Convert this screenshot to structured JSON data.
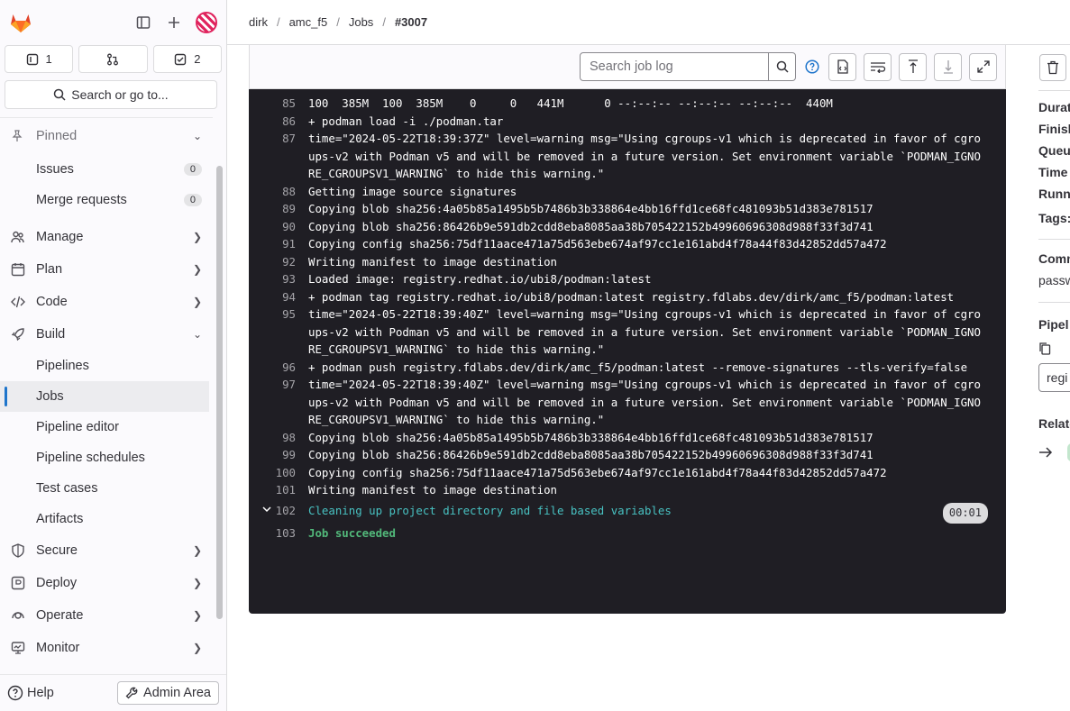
{
  "sidebar": {
    "issues_count": "1",
    "todos_count": "2",
    "search_label": "Search or go to...",
    "pinned_label": "Pinned",
    "pinned_items": [
      {
        "label": "Issues",
        "badge": "0"
      },
      {
        "label": "Merge requests",
        "badge": "0"
      }
    ],
    "sections": {
      "manage": "Manage",
      "plan": "Plan",
      "code": "Code",
      "build": "Build",
      "secure": "Secure",
      "deploy": "Deploy",
      "operate": "Operate",
      "monitor": "Monitor"
    },
    "build_items": [
      "Pipelines",
      "Jobs",
      "Pipeline editor",
      "Pipeline schedules",
      "Test cases",
      "Artifacts"
    ],
    "help_label": "Help",
    "admin_label": "Admin Area"
  },
  "breadcrumb": [
    "dirk",
    "amc_f5",
    "Jobs",
    "#3007"
  ],
  "log_toolbar": {
    "search_placeholder": "Search job log"
  },
  "log_lines": [
    {
      "n": "85",
      "t": "100  385M  100  385M    0     0   441M      0 --:--:-- --:--:-- --:--:--  440M"
    },
    {
      "n": "86",
      "t": "+ podman load -i ./podman.tar"
    },
    {
      "n": "87",
      "t": "time=\"2024-05-22T18:39:37Z\" level=warning msg=\"Using cgroups-v1 which is deprecated in favor of cgroups-v2 with Podman v5 and will be removed in a future version. Set environment variable `PODMAN_IGNORE_CGROUPSV1_WARNING` to hide this warning.\""
    },
    {
      "n": "88",
      "t": "Getting image source signatures"
    },
    {
      "n": "89",
      "t": "Copying blob sha256:4a05b85a1495b5b7486b3b338864e4bb16ffd1ce68fc481093b51d383e781517"
    },
    {
      "n": "90",
      "t": "Copying blob sha256:86426b9e591db2cdd8eba8085aa38b705422152b49960696308d988f33f3d741"
    },
    {
      "n": "91",
      "t": "Copying config sha256:75df11aace471a75d563ebe674af97cc1e161abd4f78a44f83d42852dd57a472"
    },
    {
      "n": "92",
      "t": "Writing manifest to image destination"
    },
    {
      "n": "93",
      "t": "Loaded image: registry.redhat.io/ubi8/podman:latest"
    },
    {
      "n": "94",
      "t": "+ podman tag registry.redhat.io/ubi8/podman:latest registry.fdlabs.dev/dirk/amc_f5/podman:latest"
    },
    {
      "n": "95",
      "t": "time=\"2024-05-22T18:39:40Z\" level=warning msg=\"Using cgroups-v1 which is deprecated in favor of cgroups-v2 with Podman v5 and will be removed in a future version. Set environment variable `PODMAN_IGNORE_CGROUPSV1_WARNING` to hide this warning.\""
    },
    {
      "n": "96",
      "t": "+ podman push registry.fdlabs.dev/dirk/amc_f5/podman:latest --remove-signatures --tls-verify=false"
    },
    {
      "n": "97",
      "t": "time=\"2024-05-22T18:39:40Z\" level=warning msg=\"Using cgroups-v1 which is deprecated in favor of cgroups-v2 with Podman v5 and will be removed in a future version. Set environment variable `PODMAN_IGNORE_CGROUPSV1_WARNING` to hide this warning.\""
    },
    {
      "n": "98",
      "t": "Copying blob sha256:4a05b85a1495b5b7486b3b338864e4bb16ffd1ce68fc481093b51d383e781517"
    },
    {
      "n": "99",
      "t": "Copying blob sha256:86426b9e591db2cdd8eba8085aa38b705422152b49960696308d988f33f3d741"
    },
    {
      "n": "100",
      "t": "Copying config sha256:75df11aace471a75d563ebe674af97cc1e161abd4f78a44f83d42852dd57a472"
    },
    {
      "n": "101",
      "t": "Writing manifest to image destination"
    }
  ],
  "section_line": {
    "n": "102",
    "t": "Cleaning up project directory and file based variables",
    "duration": "00:01"
  },
  "final_line": {
    "n": "103",
    "t": "Job succeeded"
  },
  "right_panel": {
    "labels": [
      "Durat",
      "Finish",
      "Queu",
      "Time",
      "Runn",
      "Tags:"
    ],
    "commit_label": "Comm",
    "commit_text": "passw",
    "pipeline_label": "Pipel",
    "pipeline_input": "regi",
    "related_label": "Relate"
  },
  "colors": {
    "log_bg": "#1f1e24",
    "section_text": "#48c2c2",
    "success_text": "#52b87a",
    "active_indicator": "#1f75cb"
  }
}
